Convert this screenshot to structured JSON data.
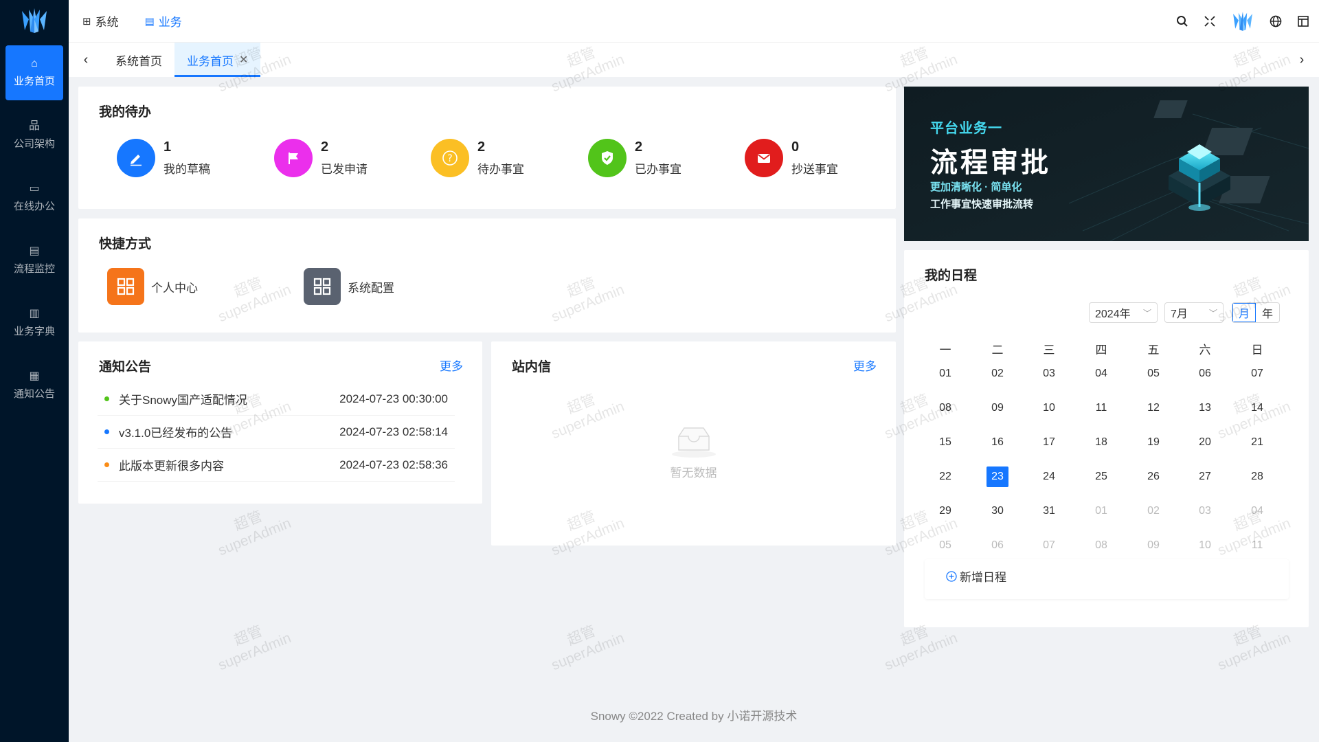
{
  "sidebar": {
    "items": [
      {
        "label": "业务首页",
        "icon": "home-icon"
      },
      {
        "label": "公司架构",
        "icon": "org-icon"
      },
      {
        "label": "在线办公",
        "icon": "desktop-icon"
      },
      {
        "label": "流程监控",
        "icon": "list-icon"
      },
      {
        "label": "业务字典",
        "icon": "book-icon"
      },
      {
        "label": "通知公告",
        "icon": "grid-icon"
      }
    ]
  },
  "header": {
    "modules": [
      {
        "label": "系统",
        "icon": "system-icon"
      },
      {
        "label": "业务",
        "icon": "business-icon"
      }
    ]
  },
  "tabs": [
    {
      "label": "系统首页"
    },
    {
      "label": "业务首页"
    }
  ],
  "todo": {
    "title": "我的待办",
    "items": [
      {
        "count": "1",
        "label": "我的草稿",
        "color": "#1677ff",
        "icon": "edit-icon"
      },
      {
        "count": "2",
        "label": "已发申请",
        "color": "#eb2fec",
        "icon": "flag-icon"
      },
      {
        "count": "2",
        "label": "待办事宜",
        "color": "#fbbf24",
        "icon": "question-icon"
      },
      {
        "count": "2",
        "label": "已办事宜",
        "color": "#52c41a",
        "icon": "shield-check-icon"
      },
      {
        "count": "0",
        "label": "抄送事宜",
        "color": "#e11d1d",
        "icon": "mail-icon"
      }
    ]
  },
  "shortcuts": {
    "title": "快捷方式",
    "items": [
      {
        "label": "个人中心",
        "color": "#f5741a",
        "icon": "apps-icon"
      },
      {
        "label": "系统配置",
        "color": "#5a6270",
        "icon": "apps-icon"
      }
    ]
  },
  "notice": {
    "title": "通知公告",
    "more": "更多",
    "rows": [
      {
        "title": "关于Snowy国产适配情况",
        "date": "2024-07-23 00:30:00",
        "dot": "#52c41a"
      },
      {
        "title": "v3.1.0已经发布的公告",
        "date": "2024-07-23 02:58:14",
        "dot": "#1677ff"
      },
      {
        "title": "此版本更新很多内容",
        "date": "2024-07-23 02:58:36",
        "dot": "#fa8c16"
      }
    ]
  },
  "messages": {
    "title": "站内信",
    "more": "更多",
    "empty": "暂无数据"
  },
  "banner": {
    "kicker": "平台业务一",
    "title": "流程审批",
    "line1": "更加清晰化 · 简单化",
    "line2": "工作事宜快速审批流转"
  },
  "schedule": {
    "title": "我的日程",
    "year": "2024年",
    "month": "7月",
    "mode_month": "月",
    "mode_year": "年",
    "weekdays": [
      "一",
      "二",
      "三",
      "四",
      "五",
      "六",
      "日"
    ],
    "weeks": [
      [
        "01",
        "02",
        "03",
        "04",
        "05",
        "06",
        "07"
      ],
      [
        "08",
        "09",
        "10",
        "11",
        "12",
        "13",
        "14"
      ],
      [
        "15",
        "16",
        "17",
        "18",
        "19",
        "20",
        "21"
      ],
      [
        "22",
        "23",
        "24",
        "25",
        "26",
        "27",
        "28"
      ],
      [
        "29",
        "30",
        "31",
        "01",
        "02",
        "03",
        "04"
      ],
      [
        "05",
        "06",
        "07",
        "08",
        "09",
        "10",
        "11"
      ]
    ],
    "selected": "23",
    "add_label": "新增日程"
  },
  "watermark": {
    "line1": "超管",
    "line2": "superAdmin"
  },
  "footer": "Snowy ©2022 Created by 小诺开源技术"
}
